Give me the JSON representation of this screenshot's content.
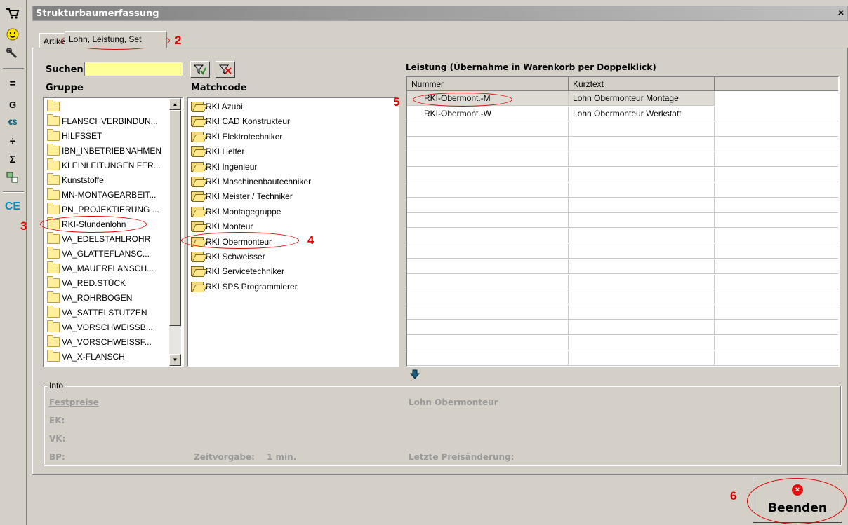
{
  "window": {
    "title": "Strukturbaumerfassung",
    "close": "×"
  },
  "toolbar": {
    "icons": [
      "cart-icon",
      "smiley-icon",
      "wrench-icon",
      "equals-icon",
      "g-icon",
      "euro-dollar-icon",
      "divide-icon",
      "sum-icon",
      "transfer-icon",
      "ce-icon"
    ],
    "labels": {
      "equals": "=",
      "g": "G",
      "euro": "€$",
      "divide": "÷",
      "sum": "Σ",
      "ce": "CE"
    }
  },
  "tabs": [
    {
      "label": "Artikel"
    },
    {
      "label": "Lohn, Leistung, Set"
    }
  ],
  "search": {
    "label": "Suchen",
    "value": ""
  },
  "gruppe": {
    "header": "Gruppe",
    "items": [
      "",
      "FLANSCHVERBINDUN...",
      "HILFSSET",
      "IBN_INBETRIEBNAHMEN",
      "KLEINLEITUNGEN FER...",
      "Kunststoffe",
      "MN-MONTAGEARBEIT...",
      "PN_PROJEKTIERUNG ...",
      "RKI-Stundenlohn",
      "VA_EDELSTAHLROHR",
      "VA_GLATTEFLANSC...",
      "VA_MAUERFLANSCH...",
      "VA_RED.STÜCK",
      "VA_ROHRBOGEN",
      "VA_SATTELSTUTZEN",
      "VA_VORSCHWEISSB...",
      "VA_VORSCHWEISSF...",
      "VA_X-FLANSCH"
    ]
  },
  "matchcode": {
    "header": "Matchcode",
    "items": [
      "RKI Azubi",
      "RKI CAD Konstrukteur",
      "RKI Elektrotechniker",
      "RKI Helfer",
      "RKI Ingenieur",
      "RKI Maschinenbautechniker",
      "RKI Meister / Techniker",
      "RKI Montagegruppe",
      "RKI Monteur",
      "RKI Obermonteur",
      "RKI Schweisser",
      "RKI Servicetechniker",
      "RKI SPS Programmierer"
    ]
  },
  "leistung": {
    "header": "Leistung (Übernahme in Warenkorb per Doppelklick)",
    "columns": [
      "Nummer",
      "Kurztext"
    ],
    "rows": [
      {
        "nummer": "RKI-Obermont.-M",
        "kurztext": "Lohn Obermonteur Montage"
      },
      {
        "nummer": "RKI-Obermont.-W",
        "kurztext": "Lohn Obermonteur Werkstatt"
      }
    ]
  },
  "info": {
    "legend": "Info",
    "festpreise": "Festpreise",
    "ek": "EK:",
    "vk": "VK:",
    "bp": "BP:",
    "zeitvorgabe_label": "Zeitvorgabe:",
    "zeitvorgabe_value": "1 min.",
    "title": "Lohn Obermonteur",
    "letzte_label": "Letzte Preisänderung:"
  },
  "beenden": {
    "label": "Beenden"
  },
  "annotations": [
    "2",
    "3",
    "4",
    "5",
    "6"
  ],
  "colors": {
    "accent_annotation": "#e00000",
    "search_bg": "#ffff99"
  }
}
